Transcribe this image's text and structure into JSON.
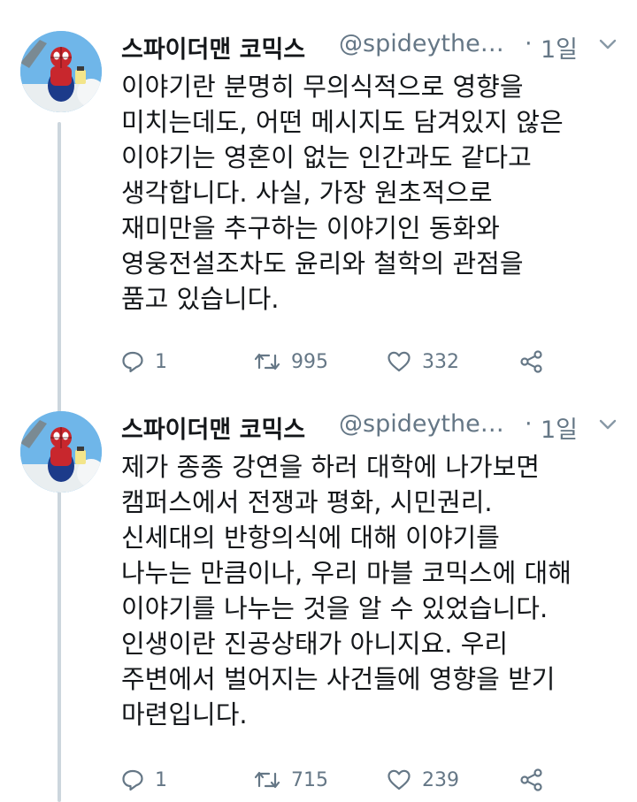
{
  "tweets": [
    {
      "author_name": "스파이더맨 코믹스",
      "handle": "@spideythe…",
      "separator": "·",
      "time": "1일",
      "text_lines": [
        "이야기란 분명히 무의식적으로 영향을",
        "미치는데도, 어떤 메시지도 담겨있지 않은",
        "이야기는 영혼이 없는 인간과도 같다고",
        "생각합니다. 사실, 가장 원초적으로",
        "재미만을 추구하는 이야기인 동화와",
        "영웅전설조차도 윤리와 철학의 관점을",
        "품고 있습니다."
      ],
      "reply_count": "1",
      "retweet_count": "995",
      "like_count": "332"
    },
    {
      "author_name": "스파이더맨 코믹스",
      "handle": "@spideythe…",
      "separator": "·",
      "time": "1일",
      "text_lines": [
        "제가 종종 강연을 하러 대학에 나가보면",
        "캠퍼스에서 전쟁과 평화, 시민권리.",
        "신세대의 반항의식에 대해 이야기를",
        "나누는 만큼이나, 우리 마블 코믹스에 대해",
        "이야기를 나누는 것을 알 수 있었습니다.",
        "인생이란 진공상태가 아니지요. 우리",
        "주변에서 벌어지는 사건들에 영향을 받기",
        "마련입니다."
      ],
      "reply_count": "1",
      "retweet_count": "715",
      "like_count": "239"
    }
  ],
  "icons": {
    "reply": "reply-icon",
    "retweet": "retweet-icon",
    "like": "heart-icon",
    "share": "share-icon",
    "menu": "chevron-down-icon",
    "avatar": "spiderman-avatar"
  },
  "colors": {
    "text": "#14171a",
    "secondary": "#657786",
    "thread_line": "#ccd6dd",
    "avatar_bg": "#6fb6e9"
  }
}
